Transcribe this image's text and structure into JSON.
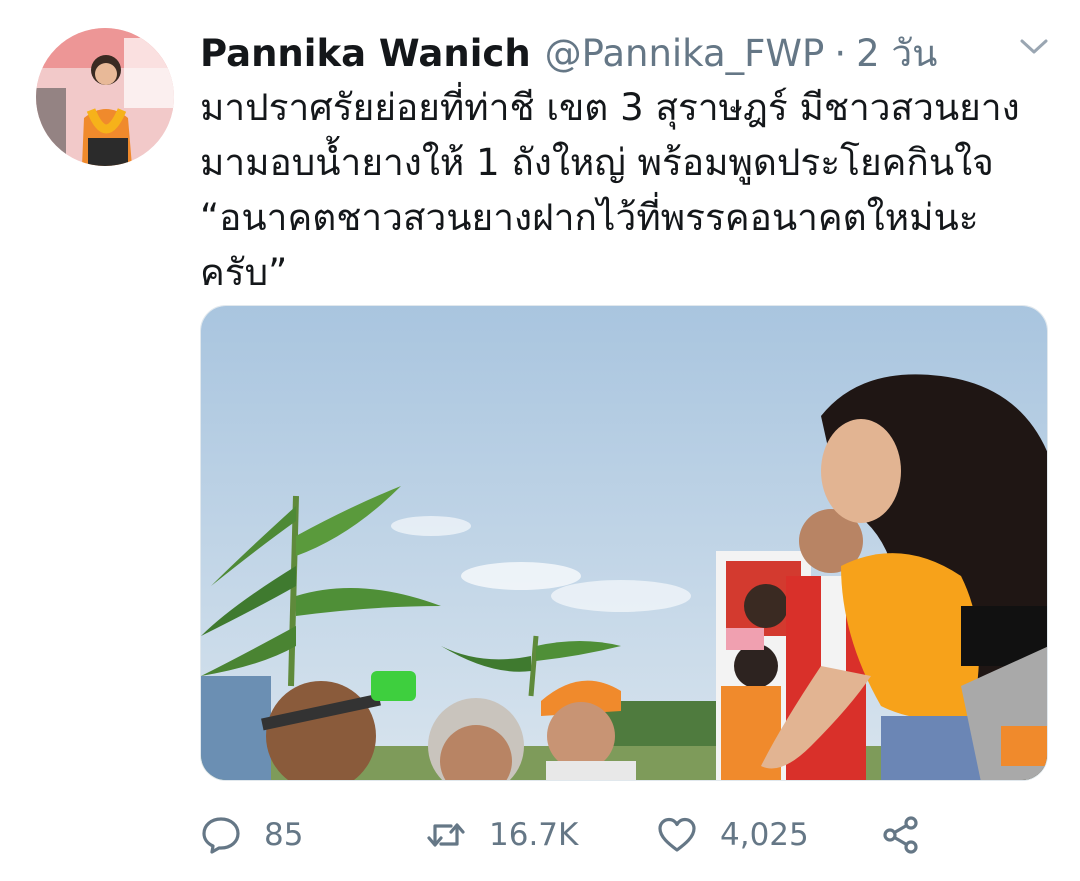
{
  "author": {
    "name": "Pannika Wanich",
    "handle": "@Pannika_FWP",
    "separator": "·",
    "time": "2 วัน"
  },
  "tweet": {
    "text": "มาปราศรัยย่อยที่ท่าชี เขต 3 สุราษฎร์ มีชาวสวนยาง\nมามอบน้ำยางให้ 1 ถังใหญ่ พร้อมพูดประโยคกินใจ\n“อนาคตชาวสวนยางฝากไว้ที่พรรคอนาคตใหม่นะ\nครับ”"
  },
  "actions": {
    "replies": "85",
    "retweets": "16.7K",
    "likes": "4,025"
  },
  "icons": {
    "reply": "reply-icon",
    "retweet": "retweet-icon",
    "like": "heart-icon",
    "share": "share-icon",
    "menu": "chevron-down-icon"
  },
  "colors": {
    "text": "#14171a",
    "secondary": "#657786",
    "accent_orange": "#f08a2c"
  }
}
